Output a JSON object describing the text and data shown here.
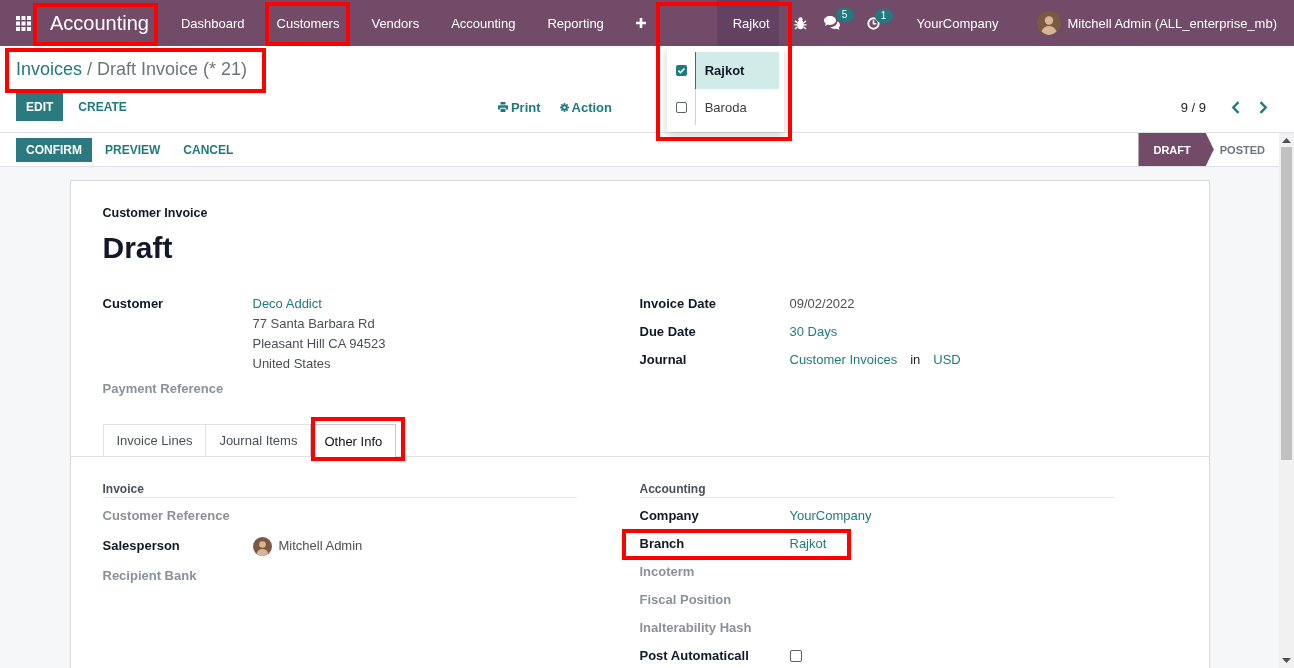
{
  "navbar": {
    "app": {
      "label": "Accounting",
      "highlighted": true
    },
    "menu": [
      {
        "label": "Dashboard",
        "highlighted": false
      },
      {
        "label": "Customers",
        "highlighted": true
      },
      {
        "label": "Vendors",
        "highlighted": false
      },
      {
        "label": "Accounting",
        "highlighted": false
      },
      {
        "label": "Reporting",
        "highlighted": false
      }
    ],
    "branch_switcher": {
      "label": "Rajkot",
      "expanded": true,
      "highlighted": true,
      "options": [
        {
          "label": "Rajkot",
          "checked": true,
          "selected": true
        },
        {
          "label": "Baroda",
          "checked": false,
          "selected": false
        }
      ]
    },
    "systray": [
      {
        "kind": "debug"
      },
      {
        "kind": "messages",
        "badge": "5"
      },
      {
        "kind": "activities",
        "badge": "1"
      }
    ],
    "company": "YourCompany",
    "user": "Mitchell Admin (ALL_enterprise_mb)"
  },
  "breadcrumb": {
    "items": [
      "Invoices",
      "Draft Invoice (* 21)"
    ],
    "separator": "/",
    "highlighted": true
  },
  "control_panel": {
    "buttons": [
      {
        "label": "EDIT",
        "primary": true
      },
      {
        "label": "CREATE",
        "primary": false
      }
    ],
    "actions": [
      {
        "kind": "print",
        "label": "Print"
      },
      {
        "kind": "action",
        "label": "Action"
      }
    ],
    "pager": "9 / 9"
  },
  "statusbar": {
    "buttons": [
      {
        "label": "CONFIRM",
        "primary": true
      },
      {
        "label": "PREVIEW",
        "primary": false
      },
      {
        "label": "CANCEL",
        "primary": false
      }
    ],
    "stages": [
      {
        "label": "DRAFT",
        "selected": true
      },
      {
        "label": "POSTED",
        "selected": false
      }
    ]
  },
  "form": {
    "subtitle": "Customer Invoice",
    "title": "Draft",
    "header_left": [
      {
        "label": "Customer",
        "kind": "address",
        "value": "Deco Addict",
        "lines": [
          "77 Santa Barbara Rd",
          "Pleasant Hill CA 94523",
          "United States"
        ]
      },
      {
        "label": "Payment Reference",
        "kind": "empty"
      }
    ],
    "header_right": [
      {
        "label": "Invoice Date",
        "kind": "text",
        "value": "09/02/2022"
      },
      {
        "label": "Due Date",
        "kind": "link",
        "value": "30 Days"
      },
      {
        "label": "Journal",
        "kind": "parts",
        "parts": [
          {
            "text": "Customer Invoices",
            "link": true
          },
          {
            "text": "in",
            "link": false
          },
          {
            "text": "USD",
            "link": true
          }
        ]
      }
    ],
    "tabs": [
      {
        "label": "Invoice Lines",
        "selected": false,
        "highlighted": false
      },
      {
        "label": "Journal Items",
        "selected": false,
        "highlighted": false
      },
      {
        "label": "Other Info",
        "selected": true,
        "highlighted": true
      }
    ],
    "groups": [
      {
        "title": "Invoice",
        "fields": [
          {
            "label": "Customer Reference",
            "kind": "empty"
          },
          {
            "label": "Salesperson",
            "kind": "user",
            "value": "Mitchell Admin"
          },
          {
            "label": "Recipient Bank",
            "kind": "empty"
          }
        ]
      },
      {
        "title": "Accounting",
        "fields": [
          {
            "label": "Company",
            "kind": "link",
            "value": "YourCompany",
            "highlighted": false
          },
          {
            "label": "Branch",
            "kind": "link",
            "value": "Rajkot",
            "highlighted": true
          },
          {
            "label": "Incoterm",
            "kind": "empty",
            "highlighted": false
          },
          {
            "label": "Fiscal Position",
            "kind": "empty",
            "highlighted": false
          },
          {
            "label": "Inalterability Hash",
            "kind": "empty",
            "highlighted": false
          },
          {
            "label": "Post Automaticall",
            "kind": "checkbox",
            "checked": false,
            "highlighted": false
          }
        ]
      }
    ]
  }
}
